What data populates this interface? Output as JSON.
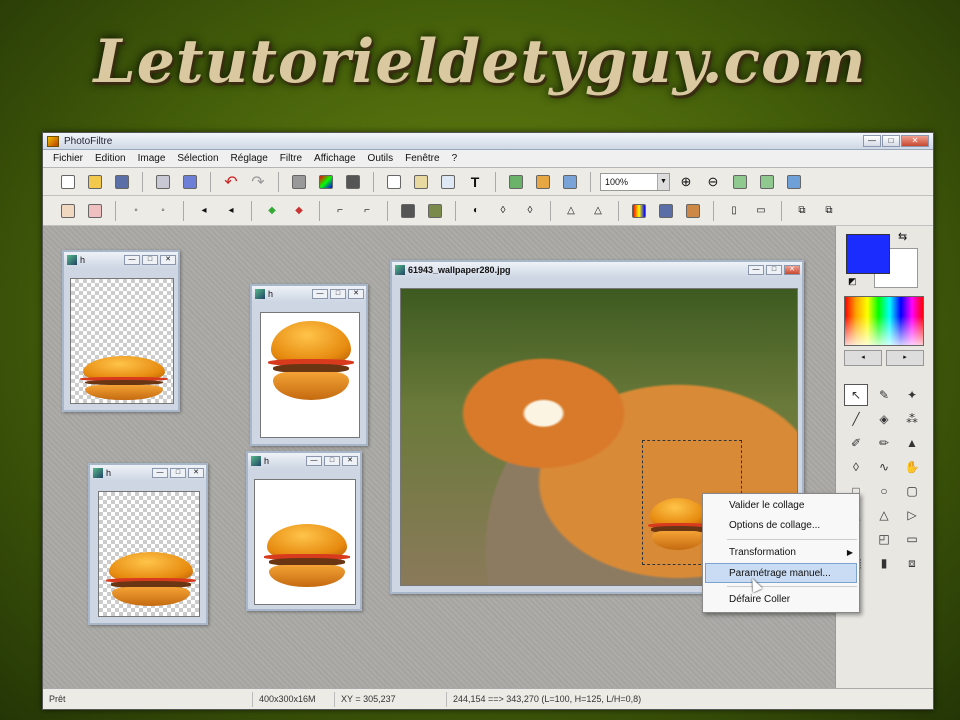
{
  "banner": {
    "text": "Letutorieldetyguy.com"
  },
  "app": {
    "title": "PhotoFiltre",
    "title_buttons": [
      "—",
      "□",
      "✕"
    ]
  },
  "menu": [
    "Fichier",
    "Edition",
    "Image",
    "Sélection",
    "Réglage",
    "Filtre",
    "Affichage",
    "Outils",
    "Fenêtre",
    "?"
  ],
  "toolbar": {
    "zoom_value": "100%"
  },
  "children": [
    {
      "title": "h"
    },
    {
      "title": "h"
    },
    {
      "title": "h"
    },
    {
      "title": "h"
    },
    {
      "title": "61943_wallpaper280.jpg"
    }
  ],
  "context_menu": {
    "items": [
      {
        "label": "Valider le collage"
      },
      {
        "label": "Options de collage..."
      },
      {
        "label": "Transformation"
      },
      {
        "label": "Paramétrage manuel..."
      },
      {
        "label": "Défaire Coller"
      }
    ]
  },
  "palette": {
    "foreground_color": "#1a2cff",
    "background_color": "#ffffff",
    "tools": [
      "select-arrow",
      "eyedropper",
      "magic-wand",
      "line",
      "fill",
      "spray",
      "brush",
      "pencil",
      "stamp",
      "drop",
      "smudge",
      "hand",
      "rect",
      "ellipse",
      "rounded-rect",
      "triangle-shape",
      "polygon",
      "arrow-shape",
      "lasso",
      "folder",
      "frame",
      "select-all",
      "text",
      "crop"
    ]
  },
  "status": {
    "state": "Prêt",
    "size": "400x300x16M",
    "xy": "XY = 305,237",
    "selection": "244,154 ==> 343,270 (L=100, H=125, L/H=0,8)"
  }
}
